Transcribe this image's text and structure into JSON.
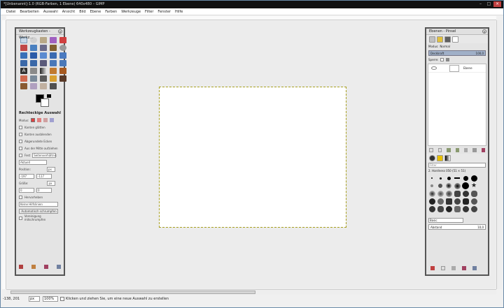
{
  "window": {
    "title": "*[Unbenannt]-1.0 (RGB-Farben, 1 Ebene) 640x480 – GIMP"
  },
  "menu": [
    "Datei",
    "Bearbeiten",
    "Auswahl",
    "Ansicht",
    "Bild",
    "Ebene",
    "Farben",
    "Werkzeuge",
    "Filter",
    "Fenster",
    "Hilfe"
  ],
  "toolbox": {
    "title": "Werkzeugkasten - Werkz...",
    "options_title": "Rechteckige Auswahl",
    "mode_label": "Modus:",
    "antialias": "Kanten glätten",
    "feather": "Kanten ausblenden",
    "rounded": "Abgerundete Ecken",
    "from_center": "Aus der Mitte aufziehen",
    "fixed_label": "Fest",
    "fixed_value": "Seitenverhältnis",
    "current": "Aktuell",
    "position_label": "Position:",
    "position_unit": "px",
    "pos_x": "-197",
    "pos_y": "-117",
    "size_label": "Größe:",
    "size_unit": "px",
    "size_w": "0",
    "size_h": "0",
    "highlight": "Hervorheben",
    "guides": "Keine Hilfslinien",
    "autoshrink": "Automatisch schrumpfen",
    "merge": "Vereinigung mitschrumpfen"
  },
  "layers": {
    "title": "Ebenen - Pinsel",
    "mode_label": "Modus:",
    "mode_value": "Normal",
    "opacity_label": "Deckkraft",
    "opacity_value": "100,0",
    "lock_label": "Sperre:",
    "layer_name": "Ebene",
    "filter_placeholder": "Filter",
    "brush_name": "2. Hardness 050 (51 × 51)",
    "brush_set": "Basic",
    "spacing_label": "Abstand",
    "spacing_value": "10,0"
  },
  "status": {
    "coords": "-138, 201",
    "unit": "px",
    "zoom": "100%",
    "message": "Klicken und ziehen Sie, um eine neue Auswahl zu erstellen"
  }
}
